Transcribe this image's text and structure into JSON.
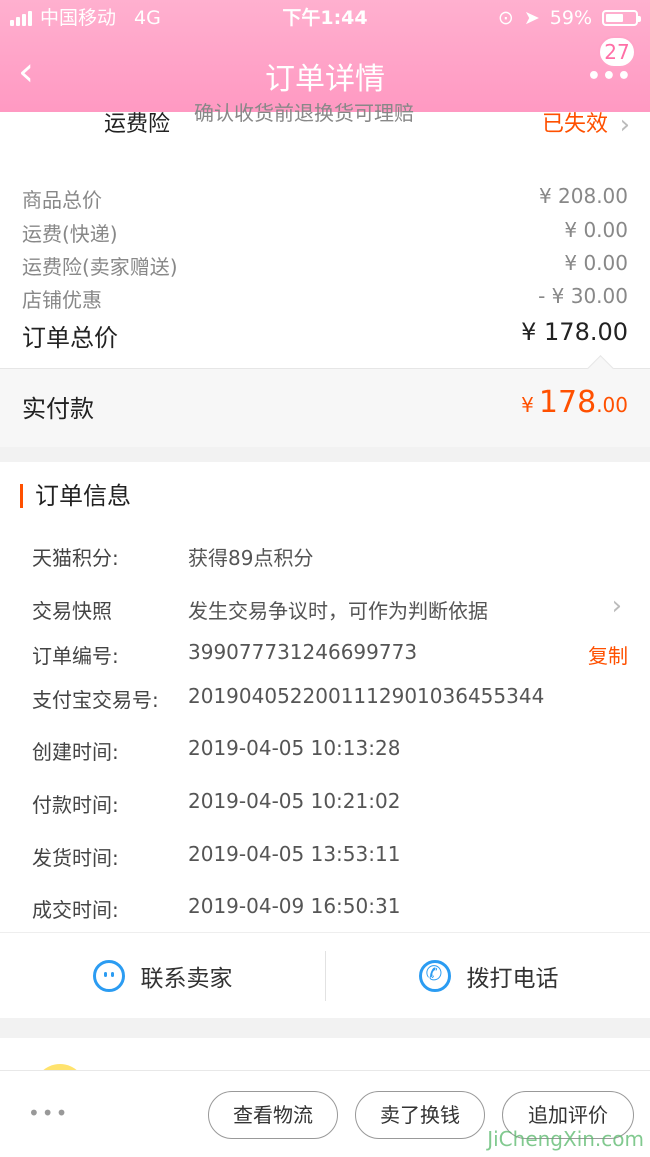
{
  "status_bar": {
    "carrier": "中国移动",
    "network": "4G",
    "time": "下午1:44",
    "battery": "59%"
  },
  "nav": {
    "title": "订单详情",
    "badge": "27"
  },
  "insurance": {
    "label": "运费险",
    "desc": "确认收货前退换货可理赔",
    "status": "已失效"
  },
  "prices": [
    {
      "label": "商品总价",
      "value": "¥ 208.00"
    },
    {
      "label": "运费(快递)",
      "value": "¥ 0.00"
    },
    {
      "label": "运费险(卖家赠送)",
      "value": "¥ 0.00"
    },
    {
      "label": "店铺优惠",
      "value": "- ¥ 30.00"
    }
  ],
  "total": {
    "label": "订单总价",
    "value": "¥ 178.00"
  },
  "paid": {
    "label": "实付款",
    "currency": "¥",
    "int": "178",
    "dec": ".00"
  },
  "order_info": {
    "title": "订单信息",
    "rows": [
      {
        "key": "天猫积分:",
        "value": "获得89点积分"
      },
      {
        "key": "交易快照",
        "value": "发生交易争议时，可作为判断依据"
      },
      {
        "key": "订单编号:",
        "value": "399077731246699773",
        "action": "复制"
      },
      {
        "key": "支付宝交易号:",
        "value": "2019040522001112901036455344"
      },
      {
        "key": "创建时间:",
        "value": "2019-04-05 10:13:28"
      },
      {
        "key": "付款时间:",
        "value": "2019-04-05 10:21:02"
      },
      {
        "key": "发货时间:",
        "value": "2019-04-05 13:53:11"
      },
      {
        "key": "成交时间:",
        "value": "2019-04-09 16:50:31"
      }
    ]
  },
  "contact": {
    "seller": "联系卖家",
    "phone": "拨打电话"
  },
  "bottom": {
    "more": "•••",
    "logistics": "查看物流",
    "resell": "卖了换钱",
    "review": "追加评价"
  },
  "watermark": "JiChengXin.com"
}
